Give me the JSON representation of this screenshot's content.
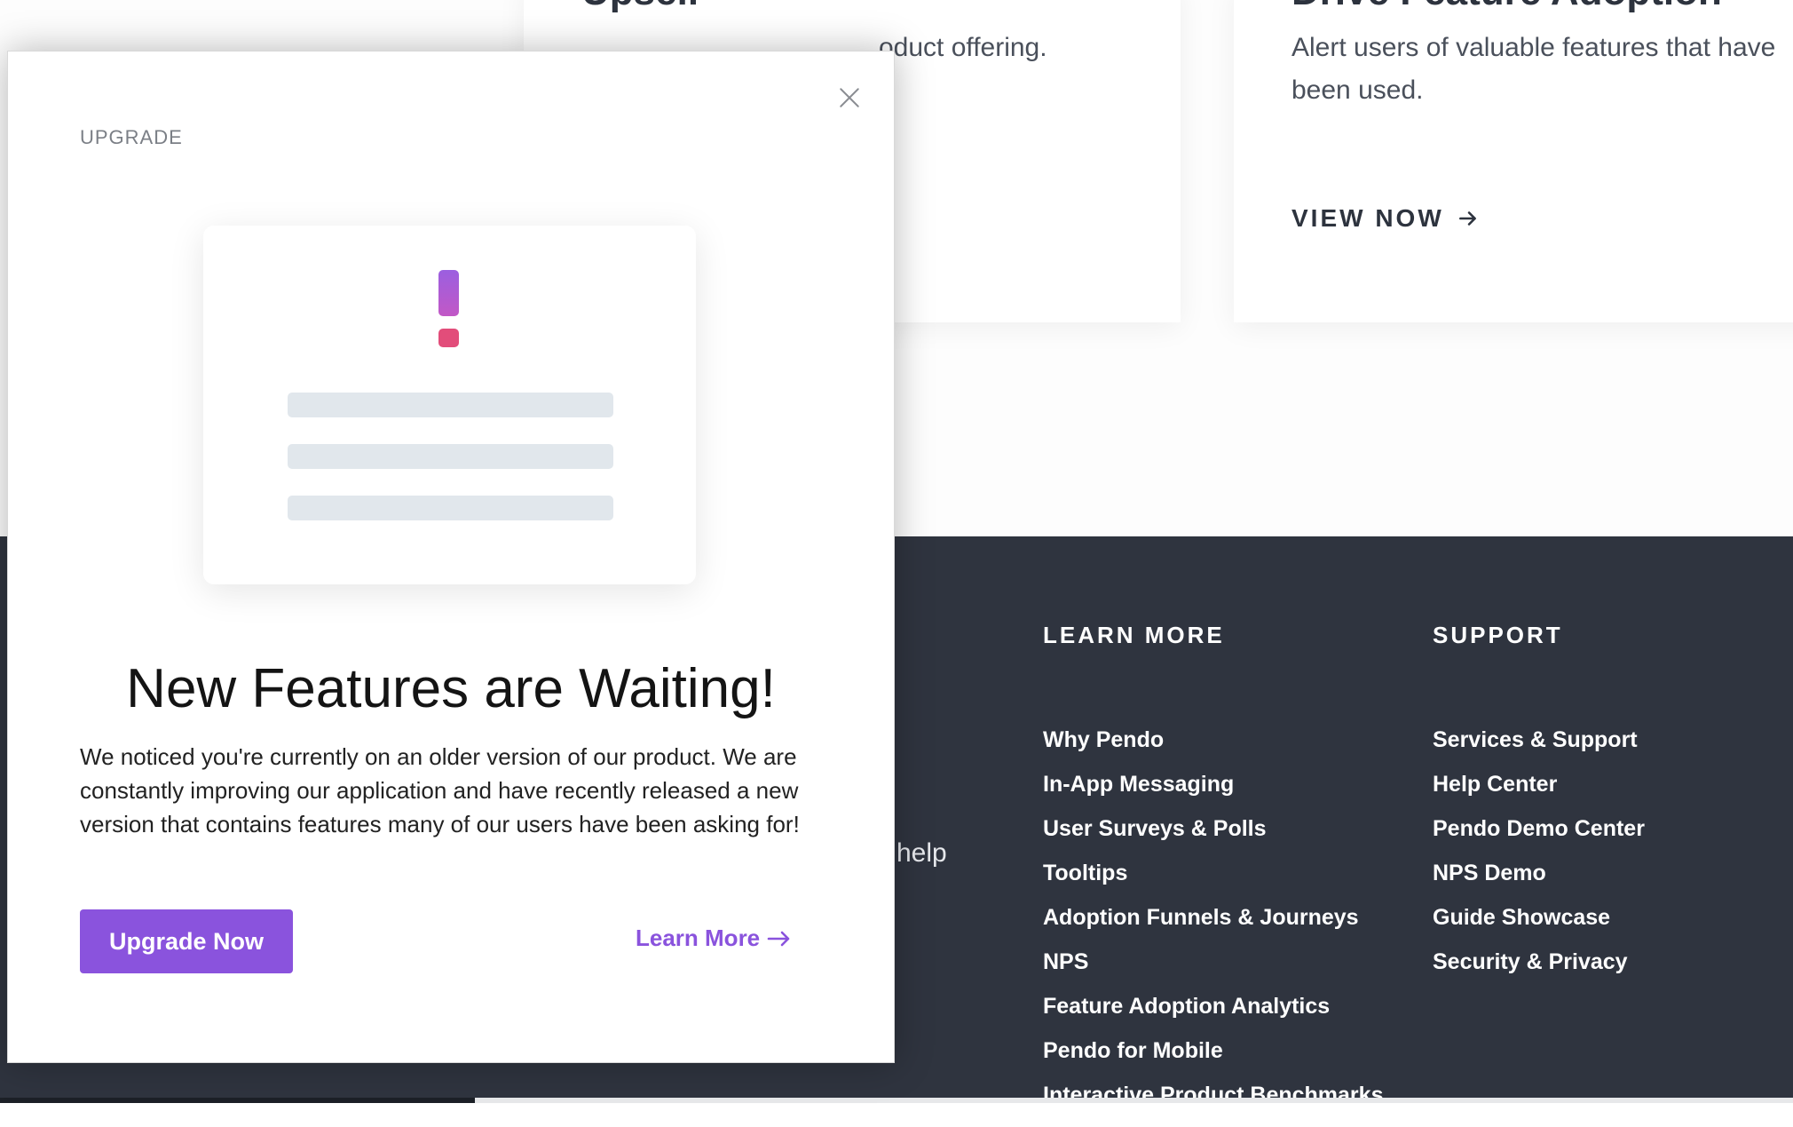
{
  "background": {
    "cards": [
      {
        "title": "Upsell",
        "description": "oduct offering."
      },
      {
        "title": "Drive Feature Adoption",
        "description": "Alert users of valuable features that have been used.",
        "cta": "VIEW NOW"
      }
    ],
    "footer": {
      "fragment": "help",
      "columns": [
        {
          "heading": "LEARN MORE",
          "links": [
            "Why Pendo",
            "In-App Messaging",
            "User Surveys & Polls",
            "Tooltips",
            "Adoption Funnels & Journeys",
            "NPS",
            "Feature Adoption Analytics",
            "Pendo for Mobile",
            "Interactive Product Benchmarks"
          ]
        },
        {
          "heading": "SUPPORT",
          "links": [
            "Services & Support",
            "Help Center",
            "Pendo Demo Center",
            "NPS Demo",
            "Guide Showcase",
            "Security & Privacy"
          ]
        }
      ]
    }
  },
  "modal": {
    "eyebrow": "UPGRADE",
    "title": "New Features are Waiting!",
    "body": "We noticed you're currently on an older version of our product. We are constantly improving our application and have recently released a new version that contains features many of our users have been asking for!",
    "primary_button": "Upgrade Now",
    "secondary_link": "Learn More",
    "icons": {
      "close": "close-icon",
      "exclamation": "exclamation-icon",
      "arrow": "arrow-right-icon"
    }
  },
  "colors": {
    "accent": "#8a53dd",
    "footer_bg": "#2f343f",
    "exclamation_top": "#9b5fe0",
    "exclamation_dot": "#e24d7a"
  }
}
